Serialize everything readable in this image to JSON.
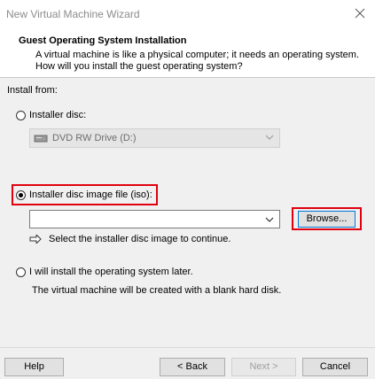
{
  "window": {
    "title": "New Virtual Machine Wizard"
  },
  "header": {
    "title": "Guest Operating System Installation",
    "description": "A virtual machine is like a physical computer; it needs an operating system. How will you install the guest operating system?"
  },
  "install_from": {
    "label": "Install from:",
    "options": [
      {
        "label": "Installer disc:",
        "selected": false
      },
      {
        "label": "Installer disc image file (iso):",
        "selected": true
      },
      {
        "label": "I will install the operating system later.",
        "selected": false
      }
    ],
    "disc_drive": {
      "value": "DVD RW Drive (D:)",
      "icon": "dvd-drive-icon"
    },
    "iso_path": {
      "value": ""
    },
    "browse_label": "Browse...",
    "hint": "Select the installer disc image to continue.",
    "later_note": "The virtual machine will be created with a blank hard disk."
  },
  "buttons": {
    "help": "Help",
    "back": "< Back",
    "next": "Next >",
    "cancel": "Cancel"
  },
  "colors": {
    "highlight": "#e0000f",
    "focus": "#0078d7"
  }
}
